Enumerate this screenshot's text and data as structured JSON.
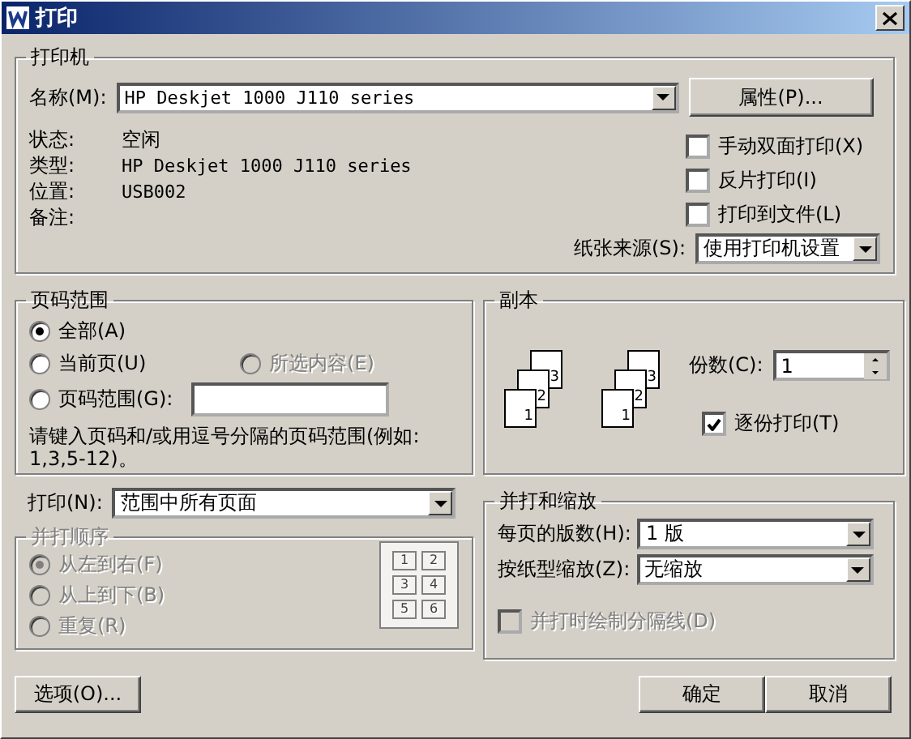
{
  "window": {
    "title": "打印"
  },
  "printer": {
    "legend": "打印机",
    "name_label": "名称(M):",
    "name_value": "HP Deskjet 1000 J110 series",
    "properties_button": "属性(P)...",
    "info": [
      {
        "label": "状态:",
        "value": "空闲"
      },
      {
        "label": "类型:",
        "value": "HP Deskjet 1000 J110 series"
      },
      {
        "label": "位置:",
        "value": "USB002"
      },
      {
        "label": "备注:"
      }
    ],
    "options": [
      {
        "label": "手动双面打印(X)",
        "checked": false
      },
      {
        "label": "反片打印(I)",
        "checked": false
      },
      {
        "label": "打印到文件(L)",
        "checked": false
      }
    ],
    "paper_source_label": "纸张来源(S):",
    "paper_source_value": "使用打印机设置"
  },
  "page_range": {
    "legend": "页码范围",
    "options": [
      {
        "label": "全部(A)",
        "selected": true,
        "disabled": false
      },
      {
        "label": "当前页(U)",
        "selected": false,
        "disabled": false
      },
      {
        "label": "所选内容(E)",
        "selected": false,
        "disabled": true
      },
      {
        "label": "页码范围(G):",
        "selected": false,
        "disabled": false
      }
    ],
    "hint": "请键入页码和/或用逗号分隔的页码范围(例如: 1,3,5-12)。"
  },
  "copies": {
    "legend": "副本",
    "stacks": [
      [
        "1",
        "2",
        "3"
      ],
      [
        "1",
        "2",
        "3"
      ]
    ],
    "count_label": "份数(C):",
    "count_value": "1",
    "collate": {
      "label": "逐份打印(T)",
      "checked": true
    }
  },
  "print_what": {
    "label": "打印(N):",
    "value": "范围中所有页面"
  },
  "order": {
    "legend": "并打顺序",
    "disabled": true,
    "options": [
      {
        "label": "从左到右(F)",
        "selected": true
      },
      {
        "label": "从上到下(B)",
        "selected": false
      },
      {
        "label": "重复(R)",
        "selected": false
      }
    ],
    "grid": [
      "1",
      "2",
      "3",
      "4",
      "5",
      "6"
    ]
  },
  "zoom": {
    "legend": "并打和缩放",
    "pages_label": "每页的版数(H):",
    "pages_value": "1 版",
    "scale_label": "按纸型缩放(Z):",
    "scale_value": "无缩放",
    "borders": {
      "label": "并打时绘制分隔线(D)",
      "checked": false,
      "disabled": true
    }
  },
  "buttons": [
    {
      "label": "选项(O)..."
    },
    {
      "label": "确定"
    },
    {
      "label": "取消"
    }
  ]
}
